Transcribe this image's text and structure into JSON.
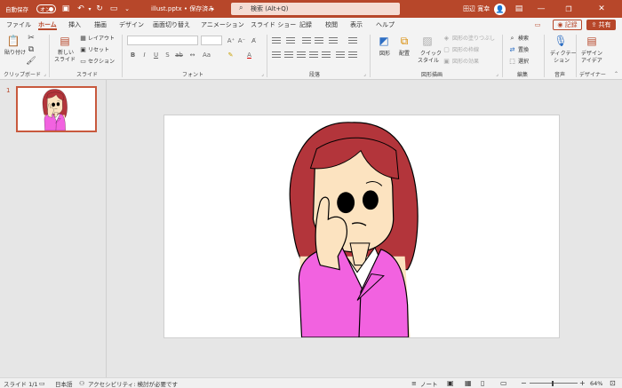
{
  "titlebar": {
    "autosave_label": "自動保存",
    "autosave_state": "オン",
    "filename": "illust.pptx • 保存済み",
    "search_placeholder": "検索 (Alt+Q)",
    "user": "田辺 寛幸",
    "avatar_initial": "👤"
  },
  "tabs": [
    "ファイル",
    "ホーム",
    "挿入",
    "描画",
    "デザイン",
    "画面切り替え",
    "アニメーション",
    "スライド ショー",
    "記録",
    "校閲",
    "表示",
    "ヘルプ"
  ],
  "tab_buttons": {
    "record": "記録",
    "share": "共有"
  },
  "ribbon": {
    "clipboard": {
      "paste": "貼り付け",
      "label": "クリップボード"
    },
    "slides": {
      "new_slide": "新しい",
      "new_slide2": "スライド",
      "layout": "レイアウト",
      "reset": "リセット",
      "section": "セクション",
      "label": "スライド"
    },
    "font": {
      "label": "フォント"
    },
    "paragraph": {
      "label": "段落"
    },
    "drawing": {
      "shapes": "図形",
      "arrange": "配置",
      "quick_styles": "クイック",
      "quick_styles2": "スタイル",
      "fill": "図形の塗りつぶし",
      "outline": "図形の枠線",
      "effects": "図形の効果",
      "label": "図形描画"
    },
    "editing": {
      "find": "検索",
      "replace": "置換",
      "select": "選択",
      "label": "編集"
    },
    "voice": {
      "dictate": "ディクテー",
      "dictate2": "ション",
      "label": "音声"
    },
    "designer": {
      "ideas": "デザイン",
      "ideas2": "アイデア",
      "label": "デザイナー"
    }
  },
  "slide_panel": {
    "slide_number": "1"
  },
  "status": {
    "slide": "スライド 1/1",
    "language": "日本語",
    "accessibility": "アクセシビリティ: 検討が必要です",
    "notes": "ノート",
    "zoom": "64%"
  },
  "colors": {
    "accent": "#b7472a",
    "hair": "#b3353b",
    "suit": "#f262e0",
    "skin": "#fce3c0"
  }
}
